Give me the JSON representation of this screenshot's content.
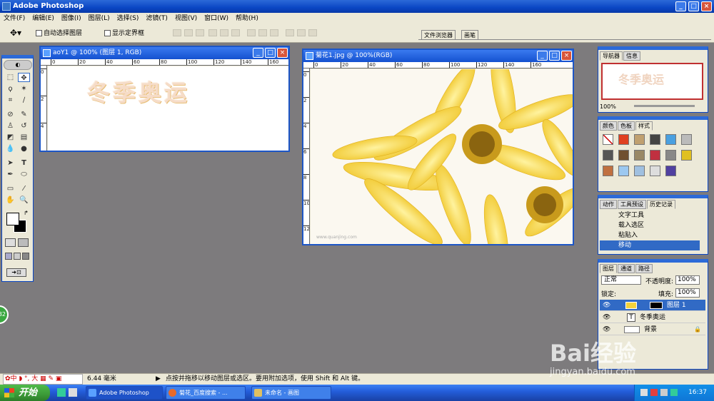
{
  "app": {
    "title": "Adobe Photoshop"
  },
  "menu": [
    "文件(F)",
    "编辑(E)",
    "图像(I)",
    "图层(L)",
    "选择(S)",
    "滤镜(T)",
    "视图(V)",
    "窗口(W)",
    "帮助(H)"
  ],
  "options": {
    "auto_select_label": "自动选择图层",
    "show_bounds_label": "显示定界框",
    "dock_tabs": [
      "文件浏览器",
      "画笔"
    ]
  },
  "doc1": {
    "title": "aoY1 @ 100% (图层 1, RGB)",
    "ruler_x": [
      "0",
      "20",
      "40",
      "60",
      "80",
      "100",
      "120",
      "140",
      "160",
      "180"
    ],
    "ruler_y": [
      "0",
      "2",
      "4",
      "6"
    ],
    "art_text": "冬季奥运"
  },
  "doc2": {
    "title": "菊花1.jpg @ 100%(RGB)",
    "ruler_x": [
      "0",
      "20",
      "40",
      "60",
      "80",
      "100",
      "120",
      "140",
      "160"
    ],
    "ruler_y": [
      "0",
      "2",
      "4",
      "6",
      "8",
      "10",
      "12"
    ],
    "watermark": "www.quanjing.com"
  },
  "navigator": {
    "tabs": [
      "导航器",
      "信息"
    ],
    "zoom": "100%",
    "preview_text": "冬季奥运"
  },
  "color_panel": {
    "tabs": [
      "颜色",
      "色板",
      "样式"
    ]
  },
  "history_panel": {
    "tabs": [
      "动作",
      "工具预设",
      "历史记录"
    ],
    "items": [
      "文字工具",
      "载入选区",
      "粘贴入",
      "移动"
    ]
  },
  "layers_panel": {
    "tabs": [
      "图层",
      "通道",
      "路径"
    ],
    "blend": "正常",
    "opacity_label": "不透明度:",
    "opacity": "100%",
    "lock_label": "锁定:",
    "fill_label": "填充:",
    "fill": "100%",
    "layers": [
      "图层 1",
      "冬季奥运",
      "背景"
    ]
  },
  "status": {
    "size": "6.44 毫米",
    "hint": "点按并拖移以移动图层或选区。要用附加选项，使用 Shift 和 Alt 键。",
    "ime": "中"
  },
  "taskbar": {
    "start": "开始",
    "tasks": [
      "Adobe Photoshop",
      "菊花_百度搜索 - ...",
      "未命名 - 画图"
    ],
    "clock": "16:37"
  },
  "watermark": {
    "brand": "Bai经验",
    "url": "jingyan.baidu.com"
  },
  "colors": {
    "title_blue": "#0a46c4",
    "flower_yellow": "#f3d23c",
    "selection": "#316ac5"
  }
}
